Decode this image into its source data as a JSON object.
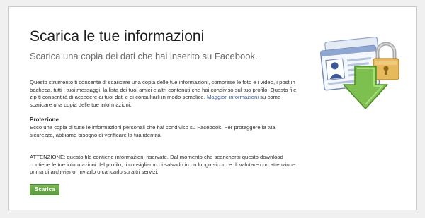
{
  "page": {
    "title": "Scarica le tue informazioni",
    "subtitle": "Scarica una copia dei dati che hai inserito su Facebook."
  },
  "intro": {
    "text": "Questo strumento ti consente di scaricare una copia delle tue informazioni, comprese le foto e i video, i post in bacheca, tutti i tuoi messaggi, la lista dei tuoi amici e altri contenuti che hai condiviso sul tuo profilo. Questo file zip ti consentirà di accedere ai tuoi dati e di consultarli in modo semplice.",
    "link_label": "Maggiori informazioni",
    "link_suffix": " su come scaricare una copia delle tue informazioni."
  },
  "protection": {
    "heading": "Protezione",
    "text": "Ecco una copia di tutte le informazioni personali che hai condiviso su Facebook. Per proteggere la tua sicurezza, abbiamo bisogno di verificare la tua identità."
  },
  "warning": {
    "text": "ATTENZIONE: questo file contiene informazioni riservate. Dal momento che scaricherai questo download contiene le tue informazioni del profilo, ti consigliamo di salvarlo in un luogo sicuro e di valutare con attenzione prima di archiviarlo, inviarlo o caricarlo su altri servizi."
  },
  "actions": {
    "download_label": "Scarica"
  },
  "illustration": {
    "icons": [
      "profile-card-icon",
      "lock-icon",
      "download-arrow-icon"
    ]
  }
}
